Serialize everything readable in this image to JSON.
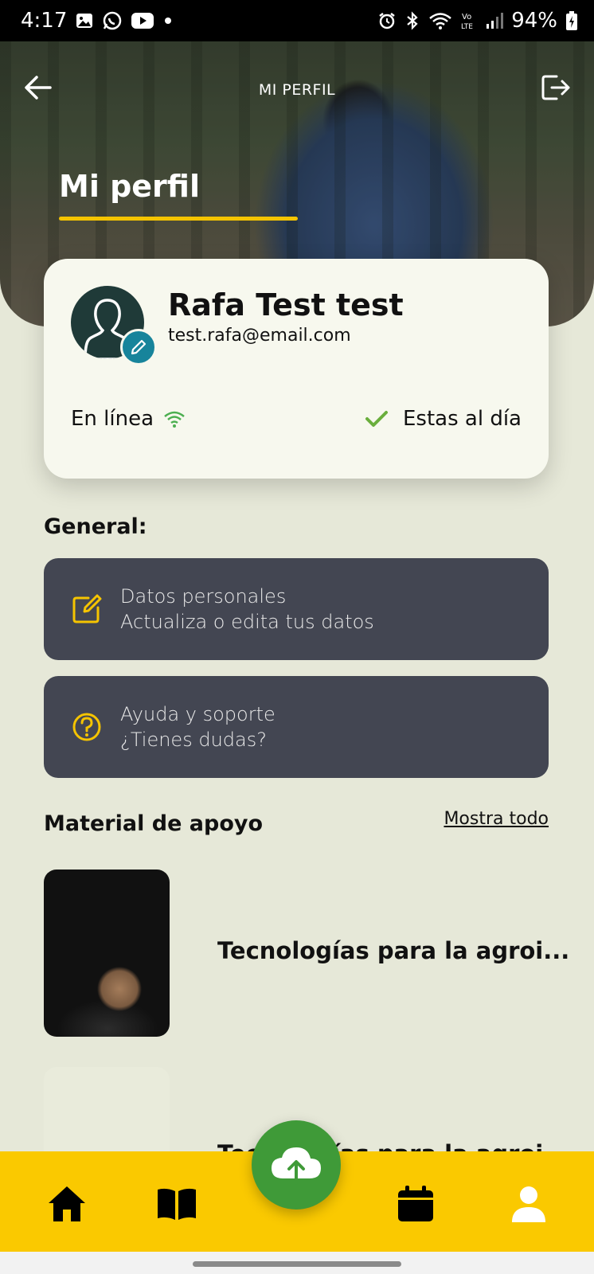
{
  "status_bar": {
    "time": "4:17",
    "battery": "94%",
    "icons_left": [
      "image-icon",
      "whatsapp-icon",
      "youtube-icon",
      "dot-icon"
    ],
    "icons_right": [
      "alarm-icon",
      "bluetooth-icon",
      "wifi-icon",
      "volte-icon",
      "signal-icon",
      "battery-icon"
    ]
  },
  "header": {
    "nav_title": "MI PERFIL",
    "title": "Mi perfil",
    "accent_color": "#f5c400"
  },
  "profile": {
    "name": "Rafa Test test",
    "email": "test.rafa@email.com",
    "online_label": "En línea",
    "sync_label": "Estas al día"
  },
  "general": {
    "title": "General:",
    "items": [
      {
        "line1": "Datos personales",
        "line2": "Actualiza o edita tus datos",
        "icon": "edit-icon"
      },
      {
        "line1": "Ayuda y soporte",
        "line2": "¿Tienes dudas?",
        "icon": "help-icon"
      }
    ]
  },
  "material": {
    "title": "Material de apoyo",
    "show_all": "Mostra todo",
    "items": [
      {
        "title": "Tecnologías para la agroi..."
      },
      {
        "title": "Tecnologías para la agroi..."
      }
    ]
  },
  "bottom_nav": {
    "items": [
      "home-icon",
      "book-icon",
      "upload-icon",
      "calendar-icon",
      "user-icon"
    ],
    "background": "#fac900",
    "fab_color": "#3f9a38"
  }
}
